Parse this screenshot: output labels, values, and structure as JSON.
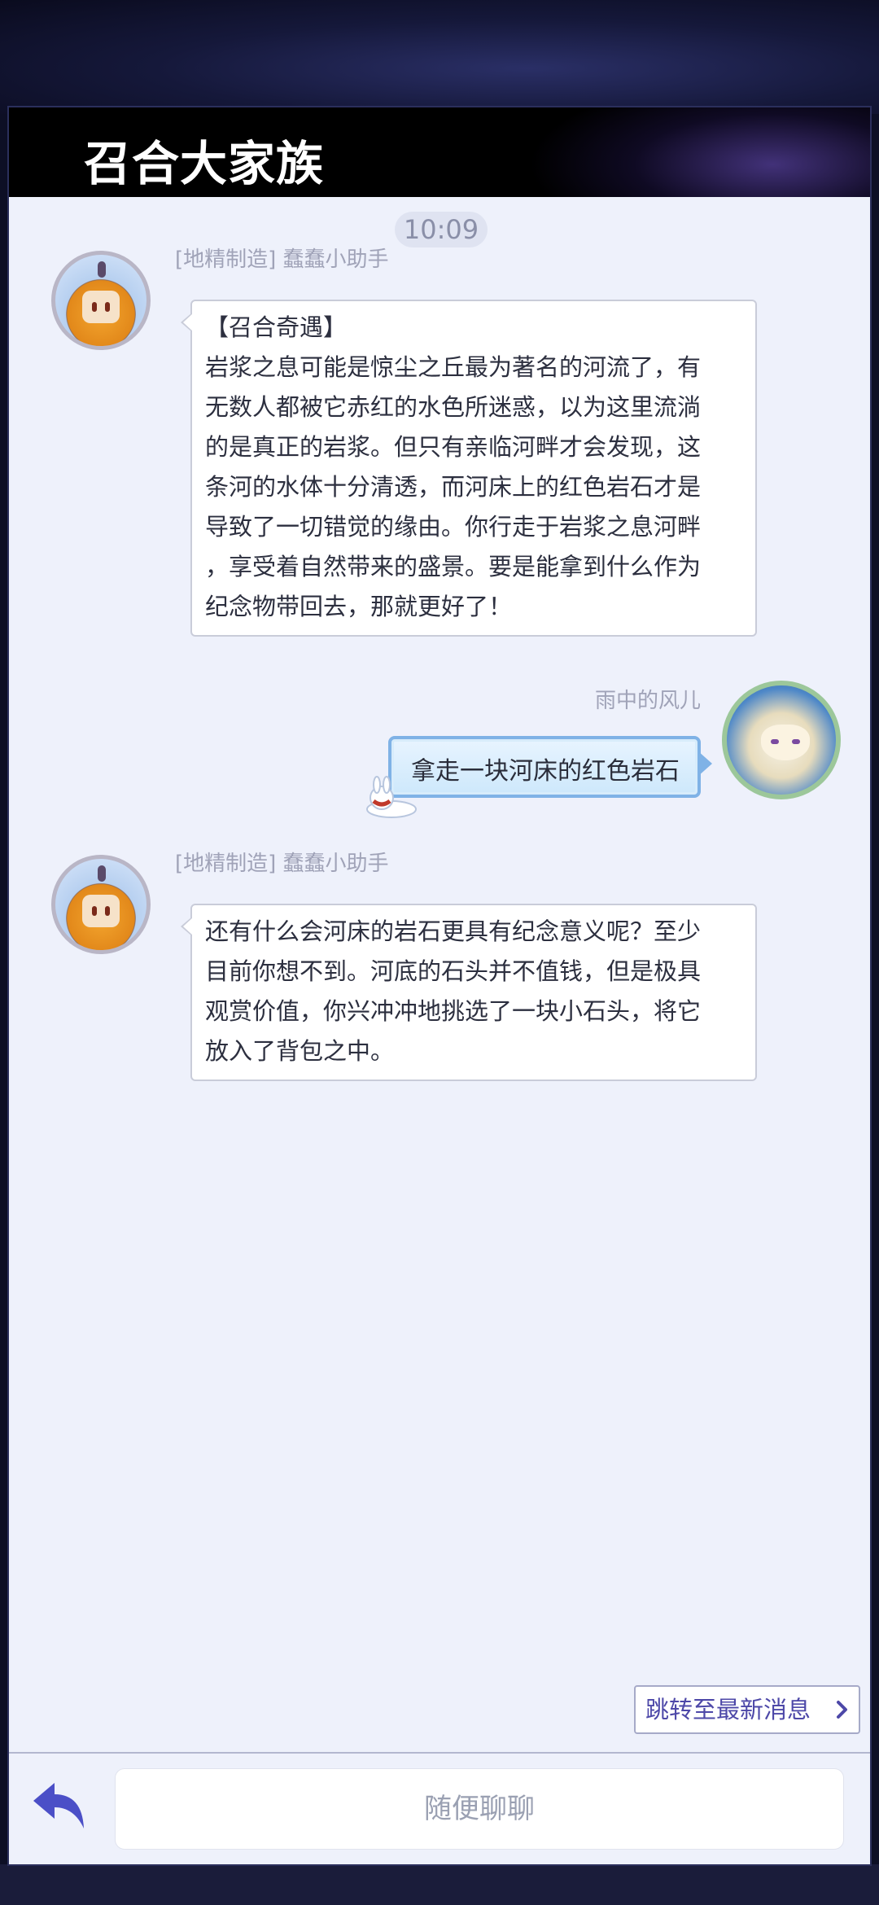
{
  "header": {
    "title": "召合大家族"
  },
  "chat": {
    "time": "10:09",
    "messages": [
      {
        "sender": "[地精制造] 蠢蠢小助手",
        "lines": [
          "【召合奇遇】",
          "岩浆之息可能是惊尘之丘最为著名的河流了，有",
          "无数人都被它赤红的水色所迷惑，以为这里流淌",
          "的是真正的岩浆。但只有亲临河畔才会发现，这",
          "条河的水体十分清透，而河床上的红色岩石才是",
          "导致了一切错觉的缘由。你行走于岩浆之息河畔",
          "，享受着自然带来的盛景。要是能拿到什么作为",
          "纪念物带回去，那就更好了！"
        ]
      },
      {
        "sender": "雨中的风儿",
        "text": "拿走一块河床的红色岩石"
      },
      {
        "sender": "[地精制造] 蠢蠢小助手",
        "lines": [
          "还有什么会河床的岩石更具有纪念意义呢？至少",
          "目前你想不到。河底的石头并不值钱，但是极具",
          "观赏价值，你兴冲冲地挑选了一块小石头，将它",
          "放入了背包之中。"
        ]
      }
    ]
  },
  "controls": {
    "jump_label": "跳转至最新消息",
    "input_placeholder": "随便聊聊"
  },
  "icons": {
    "back": "reply-arrow-icon",
    "jump": "chevron-right-icon",
    "accent": "#4d48a8"
  }
}
